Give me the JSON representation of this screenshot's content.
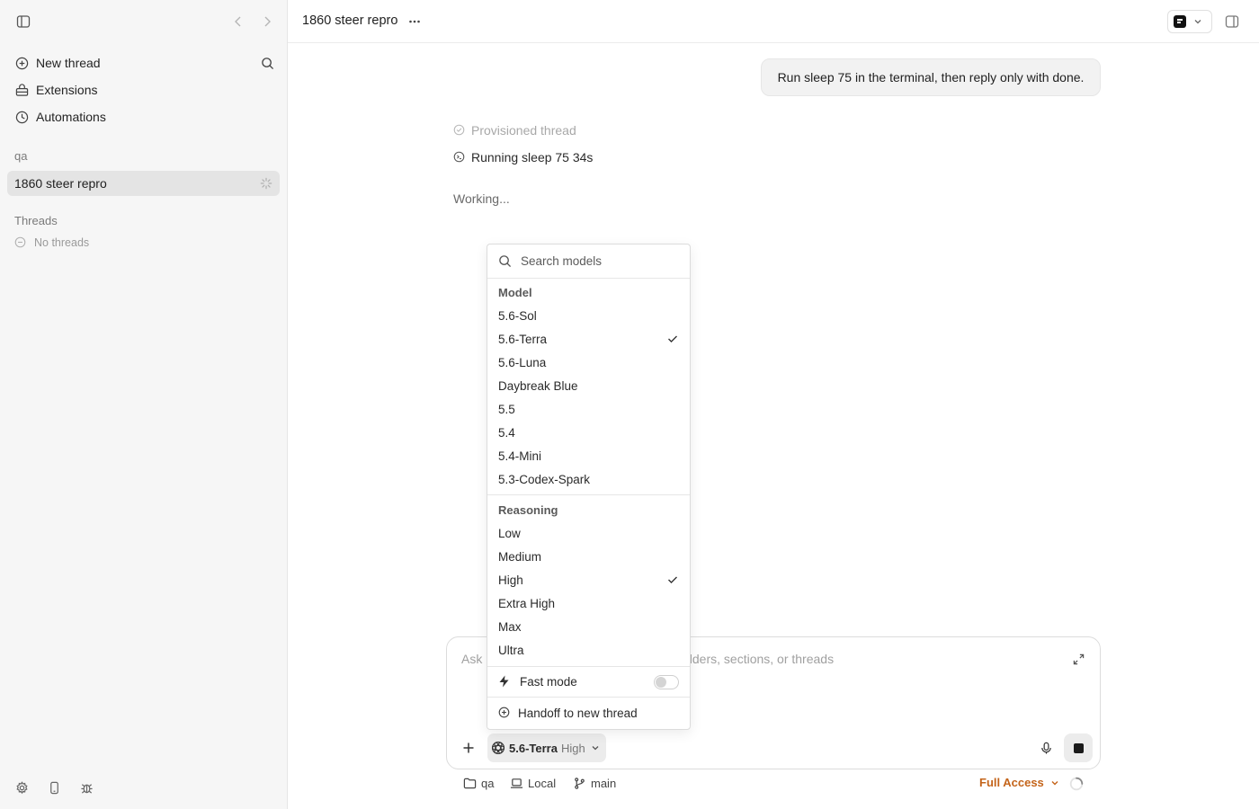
{
  "sidebar": {
    "nav": [
      {
        "label": "New thread",
        "icon": "plus-circle-icon"
      },
      {
        "label": "Extensions",
        "icon": "extensions-icon"
      },
      {
        "label": "Automations",
        "icon": "clock-icon"
      }
    ],
    "workspace_label": "qa",
    "active_thread": "1860 steer repro",
    "threads_label": "Threads",
    "no_threads": "No threads"
  },
  "header": {
    "title": "1860 steer repro"
  },
  "conversation": {
    "user_message": "Run sleep 75 in the terminal, then reply only with done.",
    "status_1": "Provisioned thread",
    "status_2": "Running sleep 75 34s",
    "working": "Working..."
  },
  "composer": {
    "placeholder_left": "Ask",
    "placeholder_right": "olders, sections, or threads",
    "model": "5.6-Terra",
    "reasoning": "High"
  },
  "footer": {
    "folder": "qa",
    "environment": "Local",
    "branch": "main",
    "access": "Full Access"
  },
  "dropdown": {
    "search_placeholder": "Search models",
    "model_heading": "Model",
    "models": [
      "5.6-Sol",
      "5.6-Terra",
      "5.6-Luna",
      "Daybreak Blue",
      "5.5",
      "5.4",
      "5.4-Mini",
      "5.3-Codex-Spark"
    ],
    "selected_model": "5.6-Terra",
    "reasoning_heading": "Reasoning",
    "reasoning_levels": [
      "Low",
      "Medium",
      "High",
      "Extra High",
      "Max",
      "Ultra"
    ],
    "selected_reasoning": "High",
    "fast_mode_label": "Fast mode",
    "fast_mode_on": false,
    "handoff_label": "Handoff to new thread"
  },
  "colors": {
    "accent_access": "#c4641a",
    "active_row_bg": "#e4e4e4"
  }
}
